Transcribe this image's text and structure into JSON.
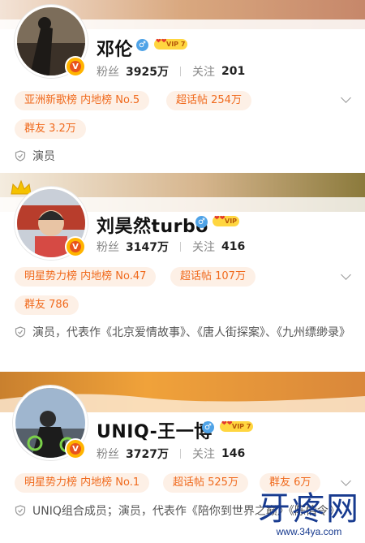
{
  "cards": [
    {
      "name": "邓伦",
      "gender_symbol": "♂",
      "vip_label": "VIP 7",
      "verified_mark": "V",
      "stats": {
        "fans_label": "粉丝",
        "fans_value": "3925万",
        "follow_label": "关注",
        "follow_value": "201"
      },
      "tags": [
        "亚洲新歌榜 内地榜 No.5",
        "超话帖 254万",
        "群友 3.2万"
      ],
      "description": "演员"
    },
    {
      "name": "刘昊然turbo",
      "gender_symbol": "♂",
      "vip_label": "VIP",
      "verified_mark": "V",
      "stats": {
        "fans_label": "粉丝",
        "fans_value": "3147万",
        "follow_label": "关注",
        "follow_value": "416"
      },
      "tags": [
        "明星势力榜 内地榜 No.47",
        "超话帖 107万",
        "群友 786"
      ],
      "description": "演员，代表作《北京爱情故事》、《唐人街探案》、《九州缥缈录》"
    },
    {
      "name": "UNIQ-王一博",
      "gender_symbol": "♂",
      "vip_label": "VIP 7",
      "verified_mark": "V",
      "stats": {
        "fans_label": "粉丝",
        "fans_value": "3727万",
        "follow_label": "关注",
        "follow_value": "146"
      },
      "tags": [
        "明星势力榜 内地榜 No.1",
        "超话帖 525万",
        "群友 6万"
      ],
      "description": "UNIQ组合成员；演员，代表作《陪你到世界之巅》《陈情令》"
    }
  ],
  "watermark": {
    "title": "牙疼网",
    "url": "www.34ya.com"
  },
  "colors": {
    "tag_bg": "#fdf0e6",
    "tag_text": "#f06a1d",
    "verified": "#ffb400",
    "vip": "#ffd640"
  }
}
